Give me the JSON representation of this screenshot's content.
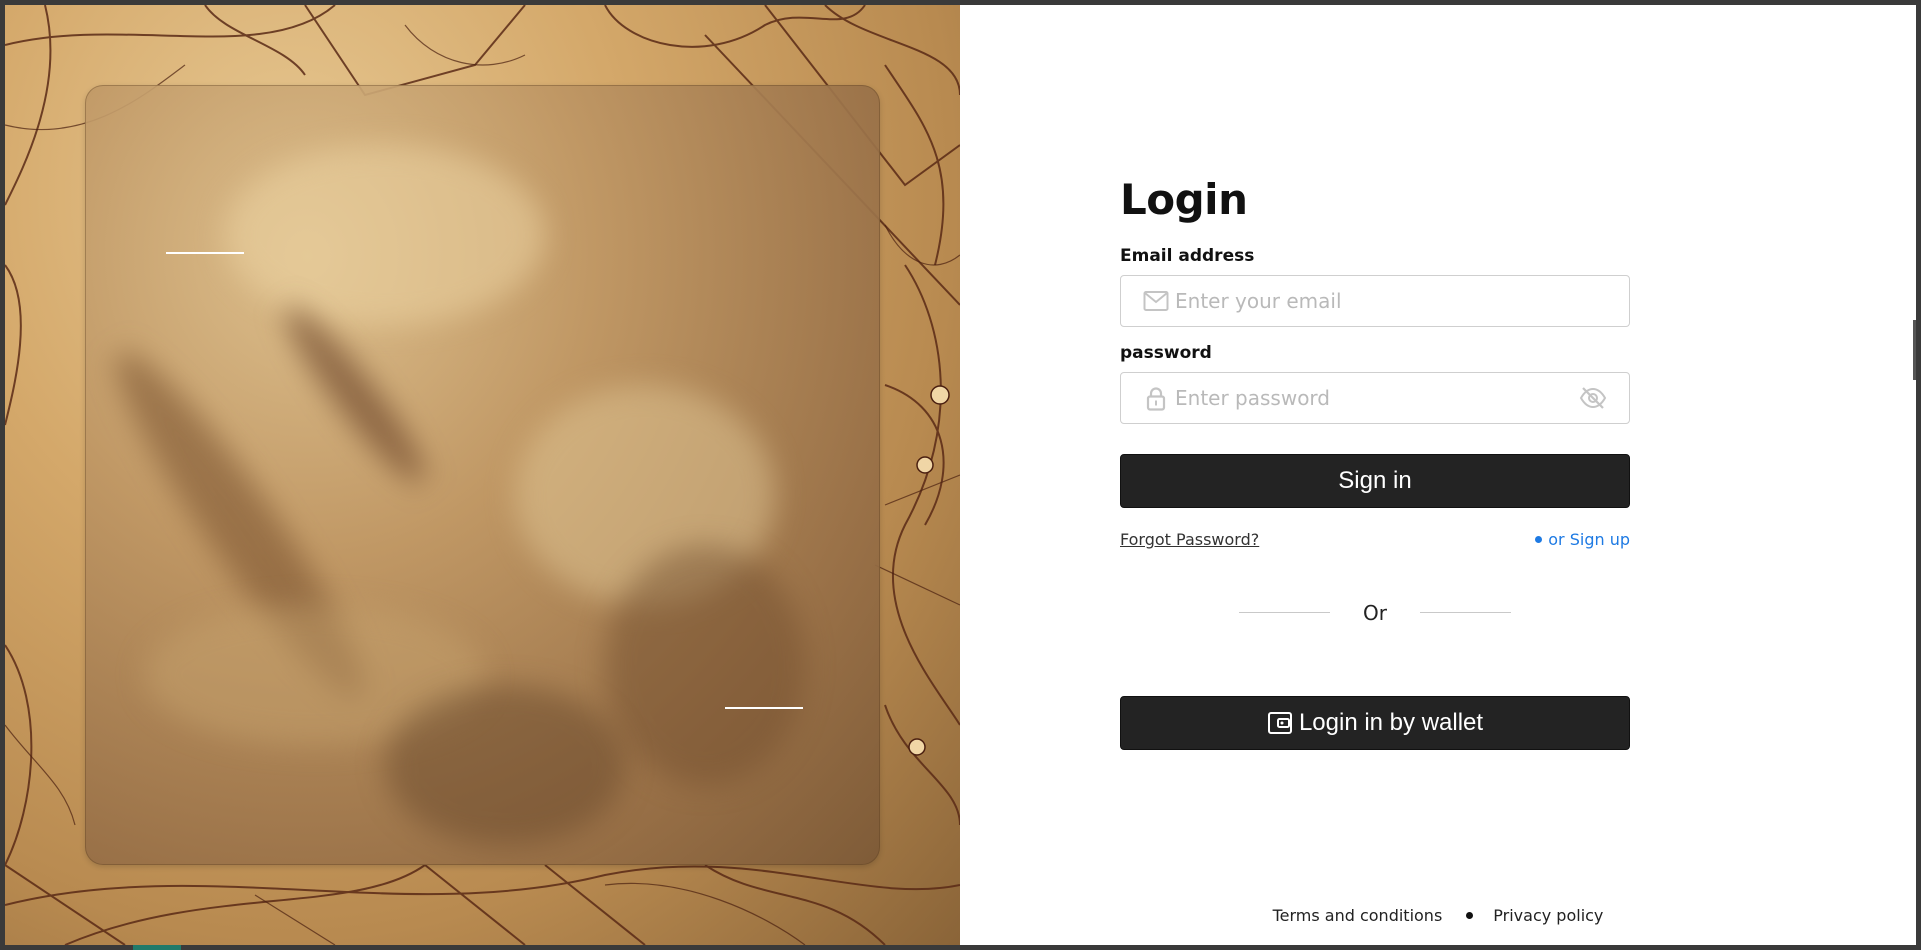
{
  "login": {
    "title": "Login",
    "email": {
      "label": "Email address",
      "placeholder": "Enter your email",
      "value": "",
      "icon": "mail-icon"
    },
    "password": {
      "label": "password",
      "placeholder": "Enter password",
      "value": "",
      "icon": "lock-icon",
      "toggle_icon": "eye-off-icon"
    },
    "signin_label": "Sign in",
    "forgot_label": "Forgot Password?",
    "signup_label": "or Sign up",
    "or_label": "Or",
    "wallet_label": "Login in by wallet",
    "wallet_icon": "wallet-icon"
  },
  "footer": {
    "terms_label": "Terms and conditions",
    "privacy_label": "Privacy policy"
  },
  "colors": {
    "button_bg": "#232323",
    "link_blue": "#1e7ae3",
    "panel_tan": "#d4a86a"
  }
}
